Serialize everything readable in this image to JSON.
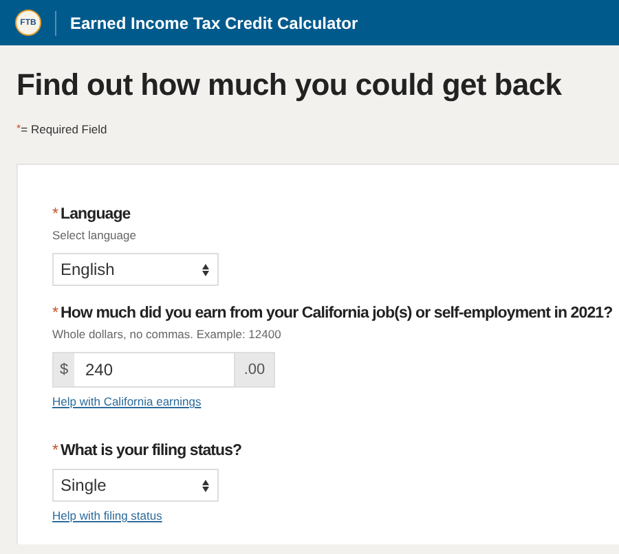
{
  "header": {
    "logo": "FTB",
    "title": "Earned Income Tax Credit Calculator"
  },
  "heading": "Find out how much you could get back",
  "required_note": {
    "marker": "*",
    "text": "= Required Field"
  },
  "fields": [
    {
      "kind": "select",
      "marker": "*",
      "label": "Language",
      "hint": "Select language",
      "value": "English"
    },
    {
      "kind": "money",
      "marker": "*",
      "label": "How much did you earn from your California job(s) or self-employment in 2021?",
      "hint": "Whole dollars, no commas. Example: 12400",
      "prefix": "$",
      "value": "240",
      "suffix": ".00",
      "help": "Help with California earnings"
    },
    {
      "kind": "select",
      "marker": "*",
      "label": "What is your filing status?",
      "value": "Single",
      "help": "Help with filing status"
    }
  ]
}
